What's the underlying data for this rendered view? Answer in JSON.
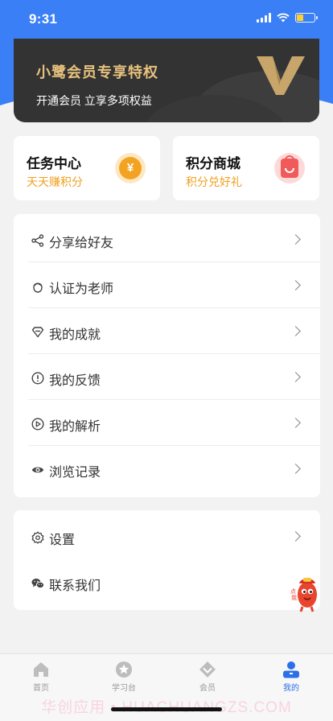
{
  "status_bar": {
    "time": "9:31"
  },
  "vip": {
    "title": "小鹭会员专享特权",
    "subtitle": "开通会员 立享多项权益",
    "accent": "#e8c27e"
  },
  "cards": [
    {
      "title": "任务中心",
      "subtitle": "天天赚积分",
      "icon": "coin-icon"
    },
    {
      "title": "积分商城",
      "subtitle": "积分兑好礼",
      "icon": "shopping-bag-icon"
    }
  ],
  "menu_main": [
    {
      "label": "分享给好友",
      "icon": "share-icon"
    },
    {
      "label": "认证为老师",
      "icon": "teacher-icon"
    },
    {
      "label": "我的成就",
      "icon": "diamond-icon"
    },
    {
      "label": "我的反馈",
      "icon": "alert-circle-icon"
    },
    {
      "label": "我的解析",
      "icon": "play-circle-icon"
    },
    {
      "label": "浏览记录",
      "icon": "eye-icon"
    }
  ],
  "menu_secondary": [
    {
      "label": "设置",
      "icon": "gear-icon"
    },
    {
      "label": "联系我们",
      "icon": "wechat-icon"
    }
  ],
  "tabs": [
    {
      "label": "首页",
      "icon": "home-icon",
      "active": false
    },
    {
      "label": "学习台",
      "icon": "star-badge-icon",
      "active": false
    },
    {
      "label": "会员",
      "icon": "vip-diamond-icon",
      "active": false
    },
    {
      "label": "我的",
      "icon": "profile-icon",
      "active": true
    }
  ],
  "watermark": "华创应用 • HUACHUANGZS.COM",
  "colors": {
    "primary": "#3a7ff6",
    "tab_active": "#2c6fe8",
    "points": "#f0a020"
  }
}
